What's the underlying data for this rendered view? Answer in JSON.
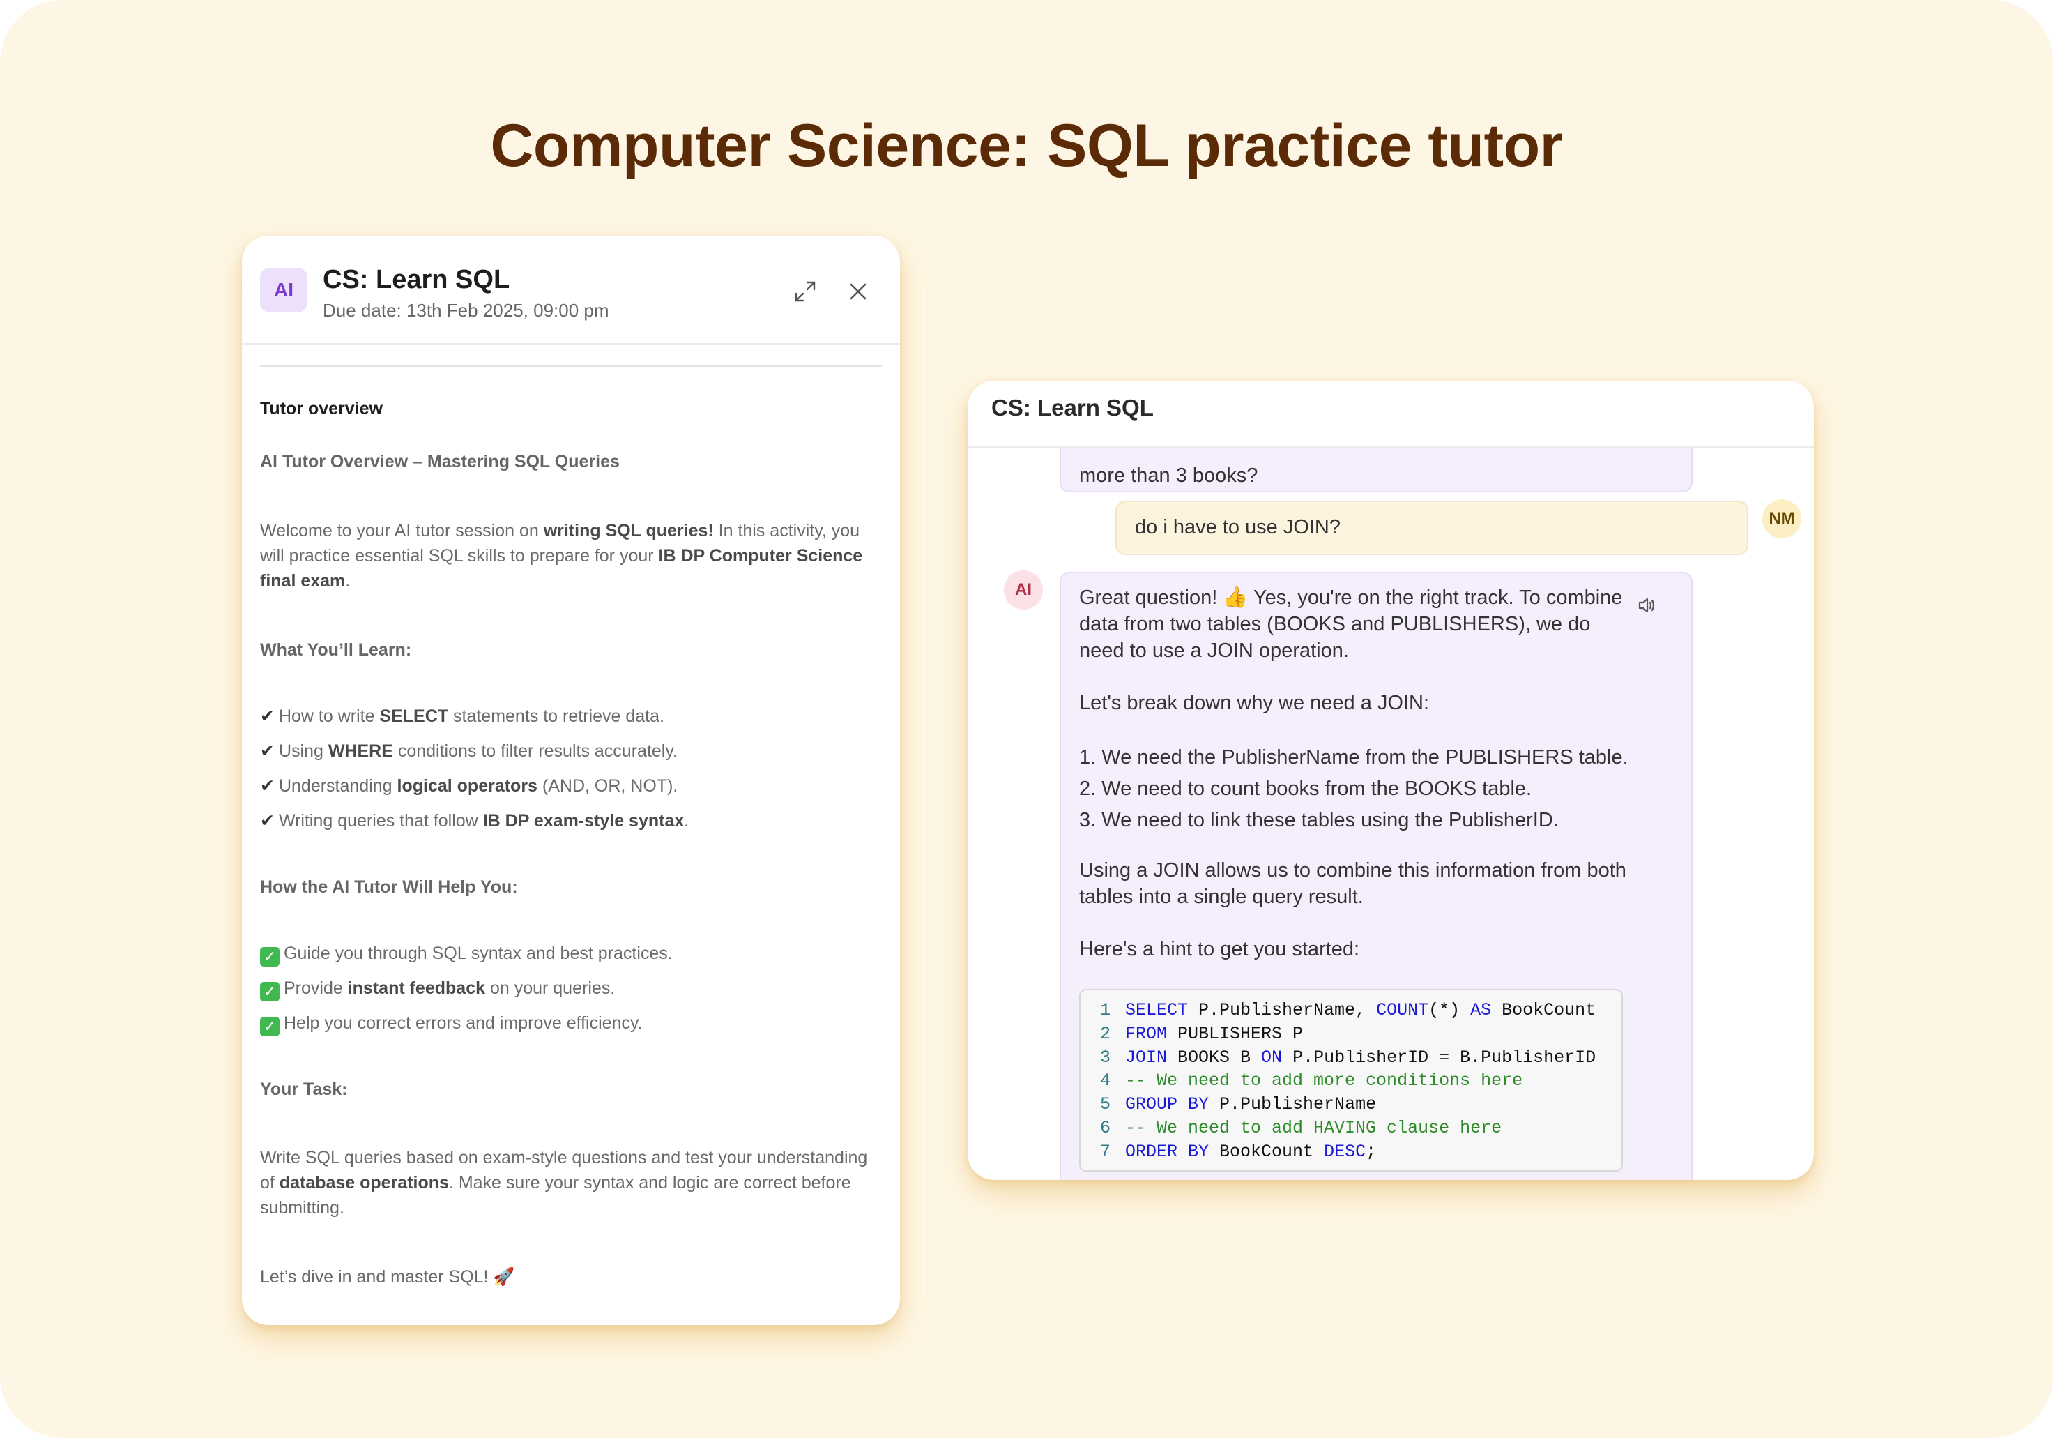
{
  "page_title": "Computer Science: SQL practice tutor",
  "left_panel": {
    "avatar": "AI",
    "title": "CS: Learn SQL",
    "due_date": "Due date: 13th Feb 2025, 09:00 pm",
    "icons": {
      "expand": "expand-icon",
      "close": "close-icon"
    },
    "overview_heading": "Tutor overview",
    "overview_subtitle": "AI Tutor Overview – Mastering SQL Queries",
    "welcome": {
      "t1": "Welcome to your AI tutor session on ",
      "b1": "writing SQL queries!",
      "t2": " In this activity, you will practice essential SQL skills to prepare for your ",
      "b2": "IB DP Computer Science final exam",
      "t3": "."
    },
    "learn_heading": "What You’ll Learn:",
    "learn_items": [
      {
        "tick": "✔",
        "pre": "How to write ",
        "bold": "SELECT",
        "post": " statements to retrieve data."
      },
      {
        "tick": "✔",
        "pre": "Using ",
        "bold": "WHERE",
        "post": " conditions to filter results accurately."
      },
      {
        "tick": "✔",
        "pre": "Understanding ",
        "bold": "logical operators",
        "post": " (AND, OR, NOT)."
      },
      {
        "tick": "✔",
        "pre": "Writing queries that follow ",
        "bold": "IB DP exam-style syntax",
        "post": "."
      }
    ],
    "help_heading": "How the AI Tutor Will Help You:",
    "help_items": [
      {
        "pre": "Guide you through SQL syntax and best practices.",
        "bold": "",
        "post": ""
      },
      {
        "pre": "Provide ",
        "bold": "instant feedback",
        "post": " on your queries."
      },
      {
        "pre": "Help you correct errors and improve efficiency.",
        "bold": "",
        "post": ""
      }
    ],
    "task_heading": "Your Task:",
    "task": {
      "t1": "Write SQL queries based on exam-style questions and test your understanding of ",
      "b1": "database operations",
      "t2": ". Make sure your syntax and logic are correct before submitting."
    },
    "closing": "Let’s dive in and master SQL! 🚀"
  },
  "right_panel": {
    "title": "CS: Learn SQL",
    "prev_message_tail": "more than 3 books?",
    "user_message": "do i have to use JOIN?",
    "user_avatar": "NM",
    "ai_avatar": "AI",
    "speaker_icon": "speaker-icon",
    "ai_intro": "Great question! 👍 Yes, you're on the right track. To combine data from two tables (BOOKS and PUBLISHERS), we do need to use a JOIN operation.",
    "ai_why": "Let's break down why we need a JOIN:",
    "ai_points": [
      "1. We need the PublisherName from the PUBLISHERS table.",
      "2. We need to count books from the BOOKS table.",
      "3. We need to link these tables using the PublisherID."
    ],
    "ai_join": "Using a JOIN allows us to combine this information from both tables into a single query result.",
    "ai_hint": "Here's a hint to get you started:",
    "code_lines": [
      [
        {
          "t": "SELECT",
          "c": "kw"
        },
        {
          "t": " P.PublisherName, ",
          "c": ""
        },
        {
          "t": "COUNT",
          "c": "kw"
        },
        {
          "t": "(*) ",
          "c": ""
        },
        {
          "t": "AS",
          "c": "kw"
        },
        {
          "t": " BookCount",
          "c": ""
        }
      ],
      [
        {
          "t": "FROM",
          "c": "kw"
        },
        {
          "t": " PUBLISHERS P",
          "c": ""
        }
      ],
      [
        {
          "t": "JOIN",
          "c": "kw"
        },
        {
          "t": " BOOKS B ",
          "c": ""
        },
        {
          "t": "ON",
          "c": "kw"
        },
        {
          "t": " P.PublisherID = B.PublisherID",
          "c": ""
        }
      ],
      [
        {
          "t": "-- We need to add more conditions here",
          "c": "cm"
        }
      ],
      [
        {
          "t": "GROUP BY",
          "c": "kw"
        },
        {
          "t": " P.PublisherName",
          "c": ""
        }
      ],
      [
        {
          "t": "-- We need to add HAVING clause here",
          "c": "cm"
        }
      ],
      [
        {
          "t": "ORDER BY",
          "c": "kw"
        },
        {
          "t": " BookCount ",
          "c": ""
        },
        {
          "t": "DESC",
          "c": "kw"
        },
        {
          "t": ";",
          "c": ""
        }
      ]
    ]
  }
}
